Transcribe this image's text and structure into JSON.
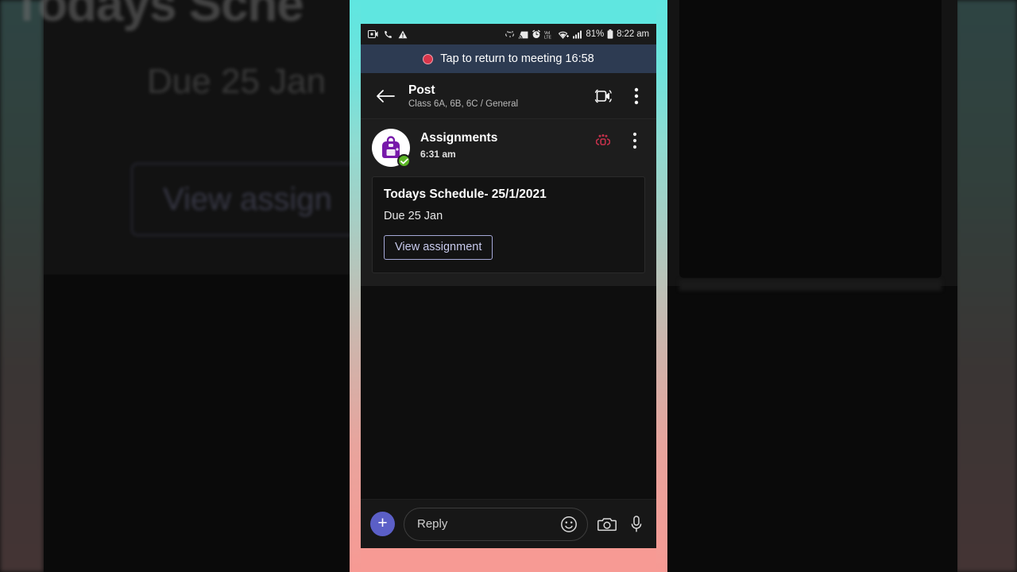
{
  "theme": {
    "frame_gradient_top": "#5FE6E0",
    "frame_gradient_mid": "#B4C6BC",
    "frame_gradient_bottom": "#F79A94",
    "banner_bg": "#2D3B52",
    "accent_purple": "#5B5FC7",
    "button_border": "#A6A9D8",
    "badge_green": "#5BB526",
    "mention_red": "#C4314B",
    "screen_bg": "#0E0E0E"
  },
  "status_bar": {
    "left_icons": [
      "video-recorder-icon",
      "phone-call-icon",
      "warning-triangle-icon"
    ],
    "right_icons": [
      "data-saver-icon",
      "cast-screen-icon",
      "alarm-clock-icon",
      "volte-icon",
      "wifi-icon",
      "signal-bars-icon"
    ],
    "volte_label": "VoLTE",
    "battery_percent": "81%",
    "battery_icon": "battery-icon",
    "time": "8:22 am"
  },
  "meeting_banner": {
    "icon": "record-dot-icon",
    "text": "Tap to return to meeting 16:58"
  },
  "toolbar": {
    "back_icon": "back-arrow-icon",
    "title": "Post",
    "subtitle": "Class 6A, 6B, 6C / General",
    "video_icon": "video-call-icon",
    "overflow_icon": "more-vertical-icon"
  },
  "post": {
    "avatar_icon": "assignments-backpack-icon",
    "verified_icon": "check-badge-icon",
    "author": "Assignments",
    "timestamp": "6:31 am",
    "mention_icon": "team-mention-icon",
    "overflow_icon": "more-vertical-icon",
    "card": {
      "title": "Todays Schedule- 25/1/2021",
      "due": "Due 25 Jan",
      "action_label": "View assignment"
    }
  },
  "reply_bar": {
    "add_icon": "plus-icon",
    "placeholder": "Reply",
    "emoji_icon": "emoji-smiley-icon",
    "camera_icon": "camera-icon",
    "mic_icon": "microphone-icon"
  },
  "background": {
    "blurred_title": "Todays Sche",
    "blurred_due": "Due 25 Jan",
    "blurred_button": "View assign"
  }
}
